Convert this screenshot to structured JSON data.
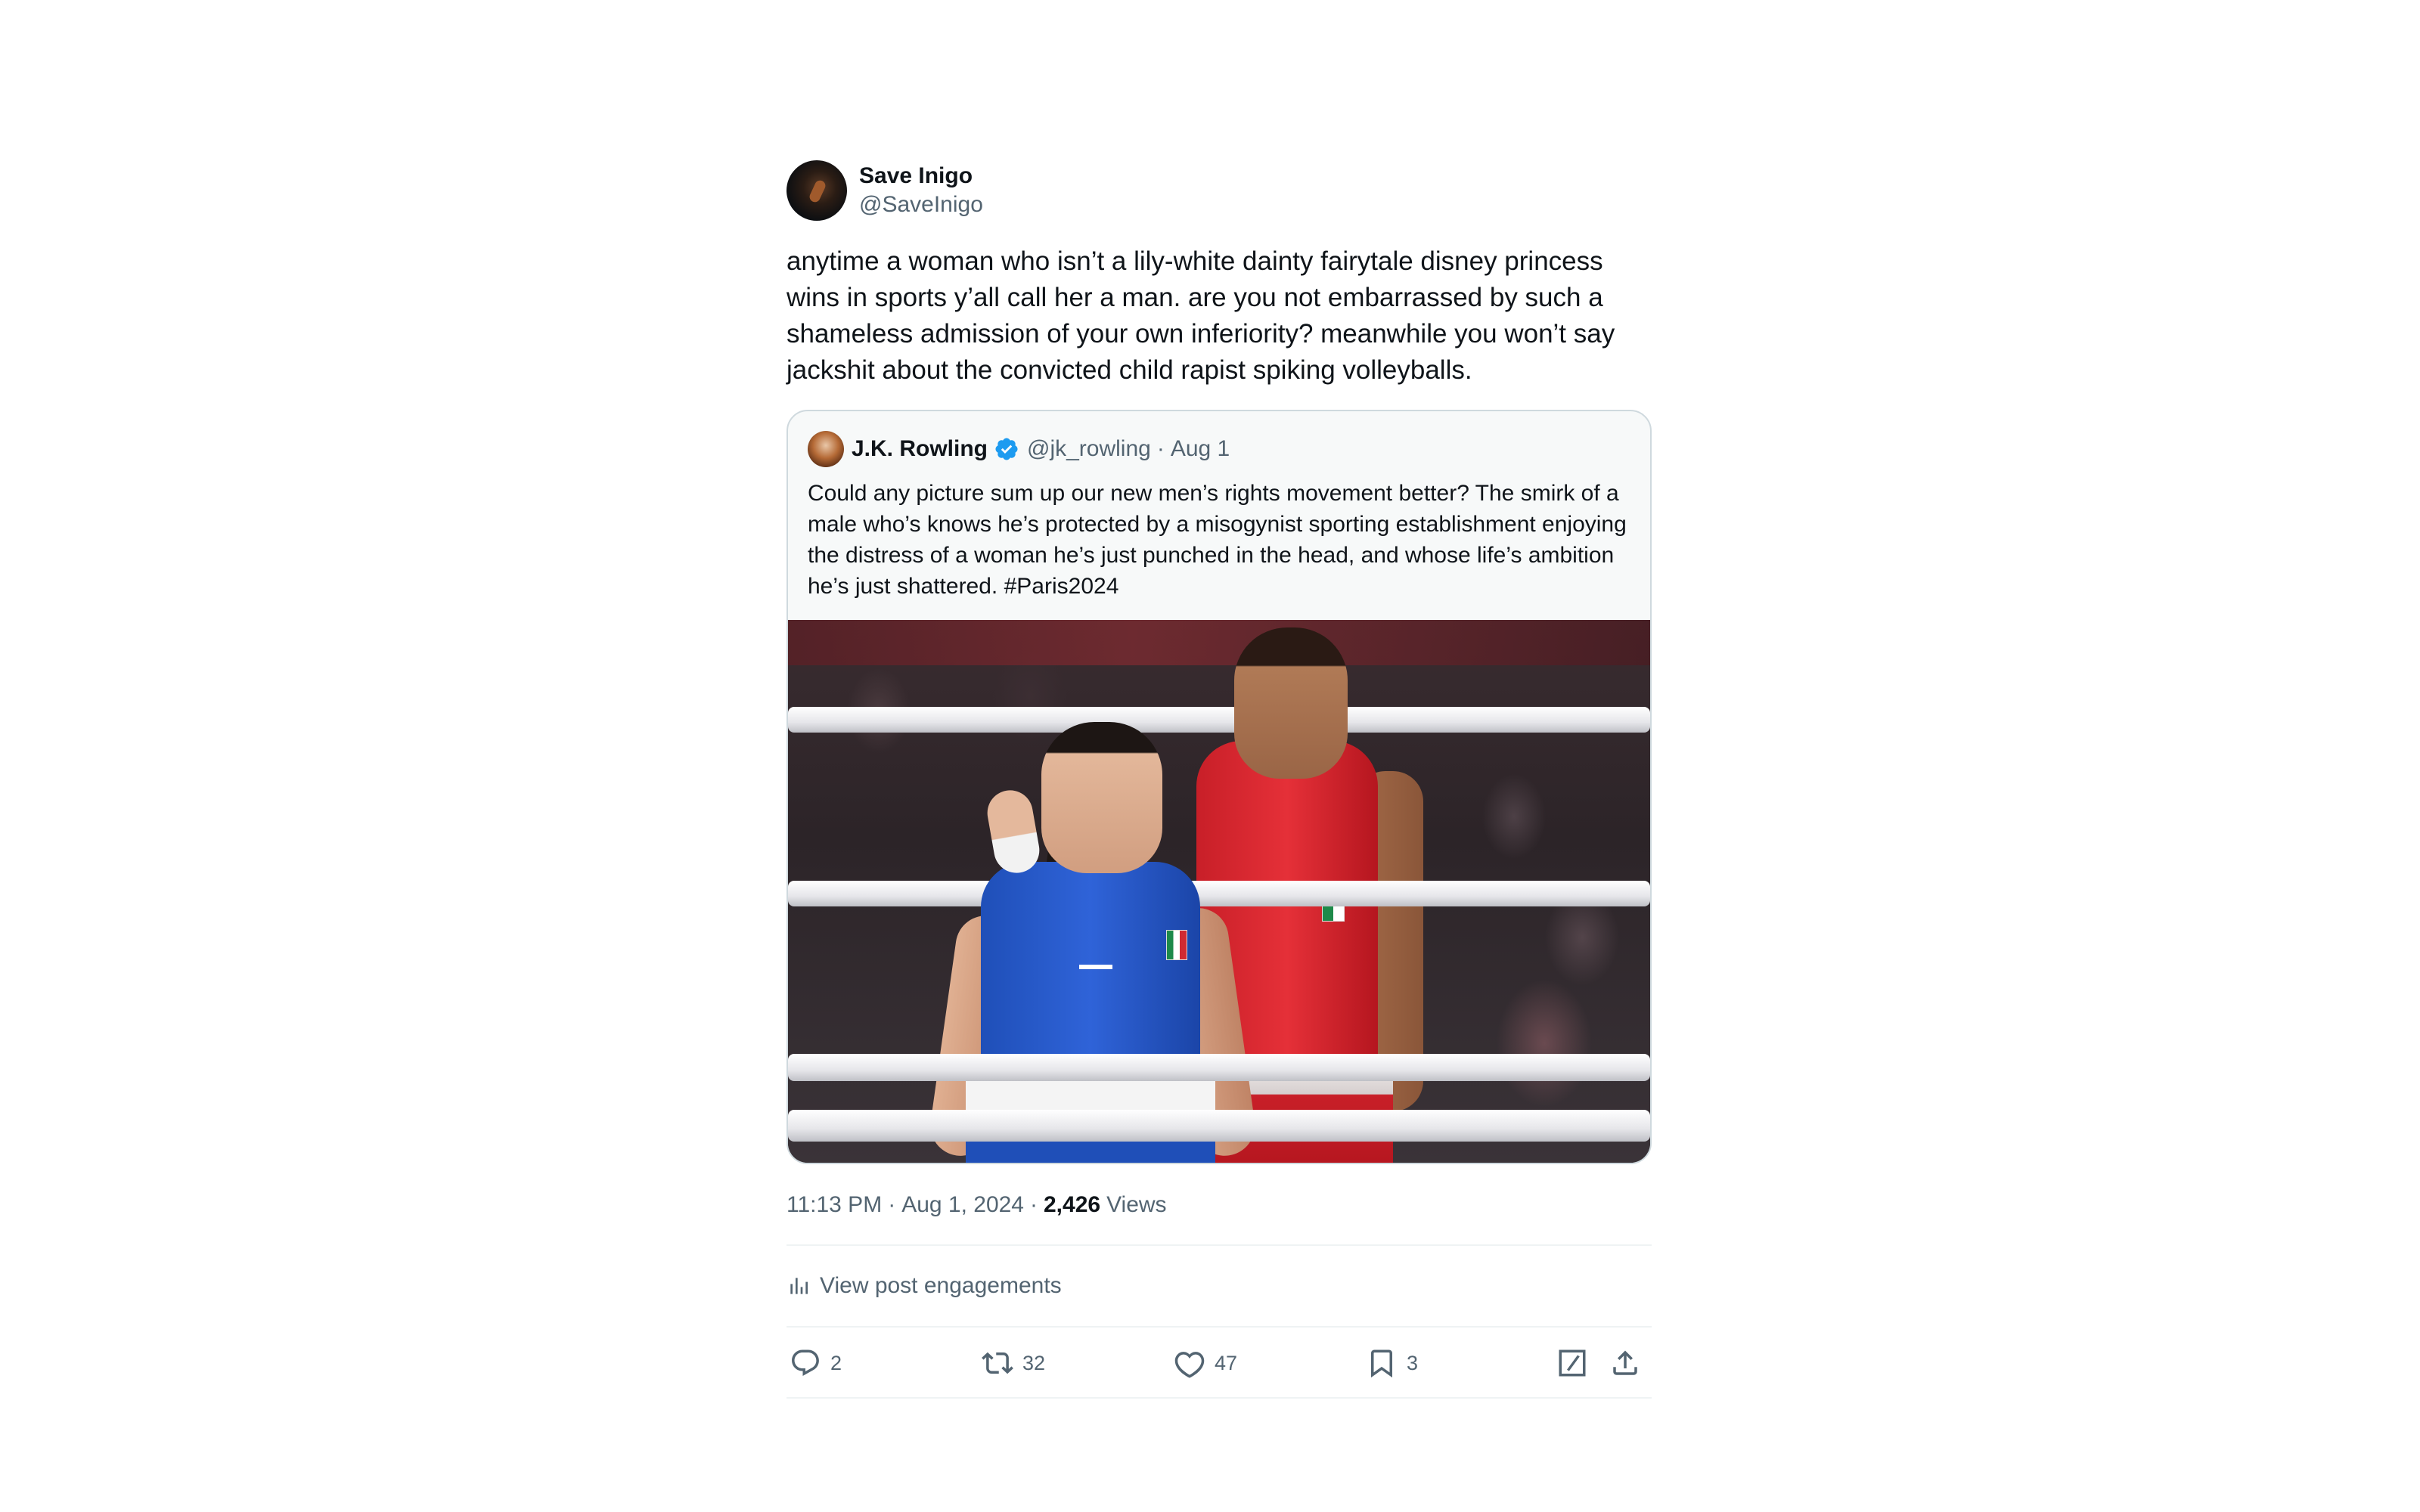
{
  "tweet": {
    "author": {
      "display_name": "Save Inigo",
      "handle": "@SaveInigo"
    },
    "text": "anytime a woman who isn’t a lily-white dainty fairytale disney princess wins in sports y’all call her a man. are you not embarrassed by such a shameless admission of your own inferiority? meanwhile you won’t say jackshit about the convicted child rapist spiking volleyballs.",
    "quote": {
      "display_name": "J.K. Rowling",
      "verified": true,
      "verified_color": "#1d9bf0",
      "handle": "@jk_rowling",
      "separator": "·",
      "date": "Aug 1",
      "text": "Could any picture sum up our new men’s rights movement better? The smirk of a male who’s knows he’s protected by a misogynist sporting establishment enjoying the distress of a woman he’s just punched in the head, and whose life’s ambition he’s just shattered. #Paris2024",
      "photo_description_icon": "boxing-photo"
    },
    "meta": {
      "time": "11:13 PM",
      "separator1": "·",
      "date": "Aug 1, 2024",
      "separator2": "·",
      "views_count": "2,426",
      "views_label": "Views"
    },
    "engagements_label": "View post engagements",
    "actions": {
      "replies": "2",
      "reposts": "32",
      "likes": "47",
      "bookmarks": "3"
    }
  },
  "colors": {
    "text": "#0f1419",
    "secondary": "#536471",
    "border": "#cfd9de",
    "divider": "#eff3f4",
    "accent": "#1d9bf0"
  },
  "icons": [
    "reply-icon",
    "repost-icon",
    "like-icon",
    "bookmark-icon",
    "grok-icon",
    "share-icon",
    "analytics-icon",
    "verified-badge-icon"
  ]
}
